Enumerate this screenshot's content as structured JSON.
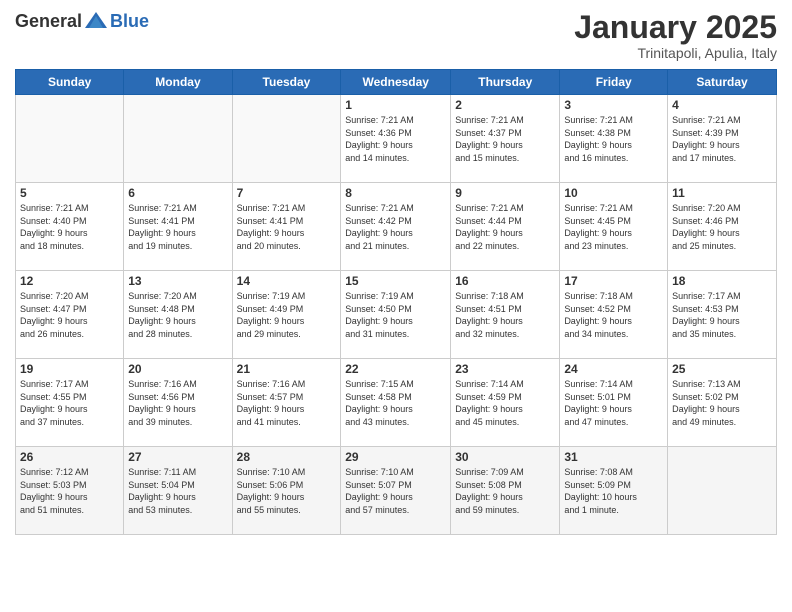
{
  "logo": {
    "text_general": "General",
    "text_blue": "Blue"
  },
  "header": {
    "title": "January 2025",
    "subtitle": "Trinitapoli, Apulia, Italy"
  },
  "weekdays": [
    "Sunday",
    "Monday",
    "Tuesday",
    "Wednesday",
    "Thursday",
    "Friday",
    "Saturday"
  ],
  "weeks": [
    [
      {
        "day": "",
        "content": ""
      },
      {
        "day": "",
        "content": ""
      },
      {
        "day": "",
        "content": ""
      },
      {
        "day": "1",
        "content": "Sunrise: 7:21 AM\nSunset: 4:36 PM\nDaylight: 9 hours\nand 14 minutes."
      },
      {
        "day": "2",
        "content": "Sunrise: 7:21 AM\nSunset: 4:37 PM\nDaylight: 9 hours\nand 15 minutes."
      },
      {
        "day": "3",
        "content": "Sunrise: 7:21 AM\nSunset: 4:38 PM\nDaylight: 9 hours\nand 16 minutes."
      },
      {
        "day": "4",
        "content": "Sunrise: 7:21 AM\nSunset: 4:39 PM\nDaylight: 9 hours\nand 17 minutes."
      }
    ],
    [
      {
        "day": "5",
        "content": "Sunrise: 7:21 AM\nSunset: 4:40 PM\nDaylight: 9 hours\nand 18 minutes."
      },
      {
        "day": "6",
        "content": "Sunrise: 7:21 AM\nSunset: 4:41 PM\nDaylight: 9 hours\nand 19 minutes."
      },
      {
        "day": "7",
        "content": "Sunrise: 7:21 AM\nSunset: 4:41 PM\nDaylight: 9 hours\nand 20 minutes."
      },
      {
        "day": "8",
        "content": "Sunrise: 7:21 AM\nSunset: 4:42 PM\nDaylight: 9 hours\nand 21 minutes."
      },
      {
        "day": "9",
        "content": "Sunrise: 7:21 AM\nSunset: 4:44 PM\nDaylight: 9 hours\nand 22 minutes."
      },
      {
        "day": "10",
        "content": "Sunrise: 7:21 AM\nSunset: 4:45 PM\nDaylight: 9 hours\nand 23 minutes."
      },
      {
        "day": "11",
        "content": "Sunrise: 7:20 AM\nSunset: 4:46 PM\nDaylight: 9 hours\nand 25 minutes."
      }
    ],
    [
      {
        "day": "12",
        "content": "Sunrise: 7:20 AM\nSunset: 4:47 PM\nDaylight: 9 hours\nand 26 minutes."
      },
      {
        "day": "13",
        "content": "Sunrise: 7:20 AM\nSunset: 4:48 PM\nDaylight: 9 hours\nand 28 minutes."
      },
      {
        "day": "14",
        "content": "Sunrise: 7:19 AM\nSunset: 4:49 PM\nDaylight: 9 hours\nand 29 minutes."
      },
      {
        "day": "15",
        "content": "Sunrise: 7:19 AM\nSunset: 4:50 PM\nDaylight: 9 hours\nand 31 minutes."
      },
      {
        "day": "16",
        "content": "Sunrise: 7:18 AM\nSunset: 4:51 PM\nDaylight: 9 hours\nand 32 minutes."
      },
      {
        "day": "17",
        "content": "Sunrise: 7:18 AM\nSunset: 4:52 PM\nDaylight: 9 hours\nand 34 minutes."
      },
      {
        "day": "18",
        "content": "Sunrise: 7:17 AM\nSunset: 4:53 PM\nDaylight: 9 hours\nand 35 minutes."
      }
    ],
    [
      {
        "day": "19",
        "content": "Sunrise: 7:17 AM\nSunset: 4:55 PM\nDaylight: 9 hours\nand 37 minutes."
      },
      {
        "day": "20",
        "content": "Sunrise: 7:16 AM\nSunset: 4:56 PM\nDaylight: 9 hours\nand 39 minutes."
      },
      {
        "day": "21",
        "content": "Sunrise: 7:16 AM\nSunset: 4:57 PM\nDaylight: 9 hours\nand 41 minutes."
      },
      {
        "day": "22",
        "content": "Sunrise: 7:15 AM\nSunset: 4:58 PM\nDaylight: 9 hours\nand 43 minutes."
      },
      {
        "day": "23",
        "content": "Sunrise: 7:14 AM\nSunset: 4:59 PM\nDaylight: 9 hours\nand 45 minutes."
      },
      {
        "day": "24",
        "content": "Sunrise: 7:14 AM\nSunset: 5:01 PM\nDaylight: 9 hours\nand 47 minutes."
      },
      {
        "day": "25",
        "content": "Sunrise: 7:13 AM\nSunset: 5:02 PM\nDaylight: 9 hours\nand 49 minutes."
      }
    ],
    [
      {
        "day": "26",
        "content": "Sunrise: 7:12 AM\nSunset: 5:03 PM\nDaylight: 9 hours\nand 51 minutes."
      },
      {
        "day": "27",
        "content": "Sunrise: 7:11 AM\nSunset: 5:04 PM\nDaylight: 9 hours\nand 53 minutes."
      },
      {
        "day": "28",
        "content": "Sunrise: 7:10 AM\nSunset: 5:06 PM\nDaylight: 9 hours\nand 55 minutes."
      },
      {
        "day": "29",
        "content": "Sunrise: 7:10 AM\nSunset: 5:07 PM\nDaylight: 9 hours\nand 57 minutes."
      },
      {
        "day": "30",
        "content": "Sunrise: 7:09 AM\nSunset: 5:08 PM\nDaylight: 9 hours\nand 59 minutes."
      },
      {
        "day": "31",
        "content": "Sunrise: 7:08 AM\nSunset: 5:09 PM\nDaylight: 10 hours\nand 1 minute."
      },
      {
        "day": "",
        "content": ""
      }
    ]
  ]
}
